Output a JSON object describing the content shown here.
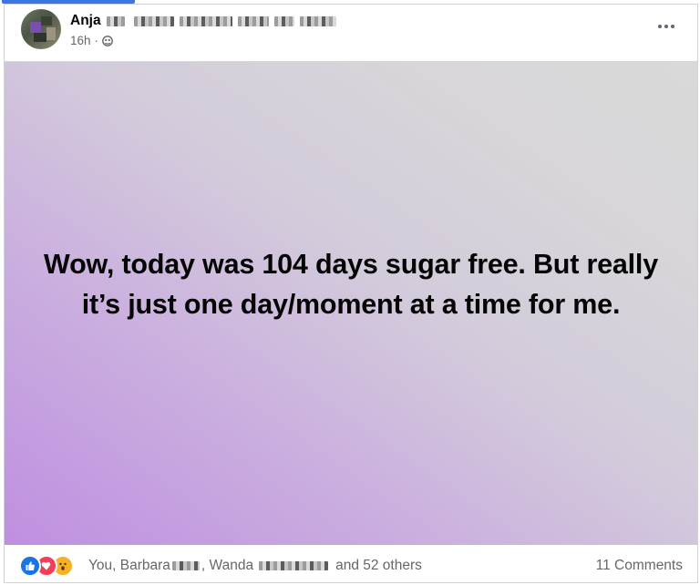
{
  "header": {
    "author_name": "Anja",
    "timestamp": "16h",
    "separator": "·",
    "audience_icon": "group-globe-icon",
    "more_icon": "more-horizontal-icon"
  },
  "post": {
    "text": "Wow, today was 104 days sugar free. But really it’s just one day/moment at a time for me.",
    "background_colors": [
      "#bf8fe0",
      "#d3cbdb",
      "#d9d9d9"
    ]
  },
  "footer": {
    "reaction_icons": [
      "like-icon",
      "love-icon",
      "wow-icon"
    ],
    "reactors_you": "You, Barbara",
    "reactors_mid": ", Wanda",
    "reactors_tail": "and 52 others",
    "comments": "11 Comments"
  },
  "colors": {
    "accent": "#3b77e0",
    "like": "#1b74e4",
    "love": "#f33e58",
    "wow": "#f7b125",
    "meta_text": "#65676b"
  }
}
